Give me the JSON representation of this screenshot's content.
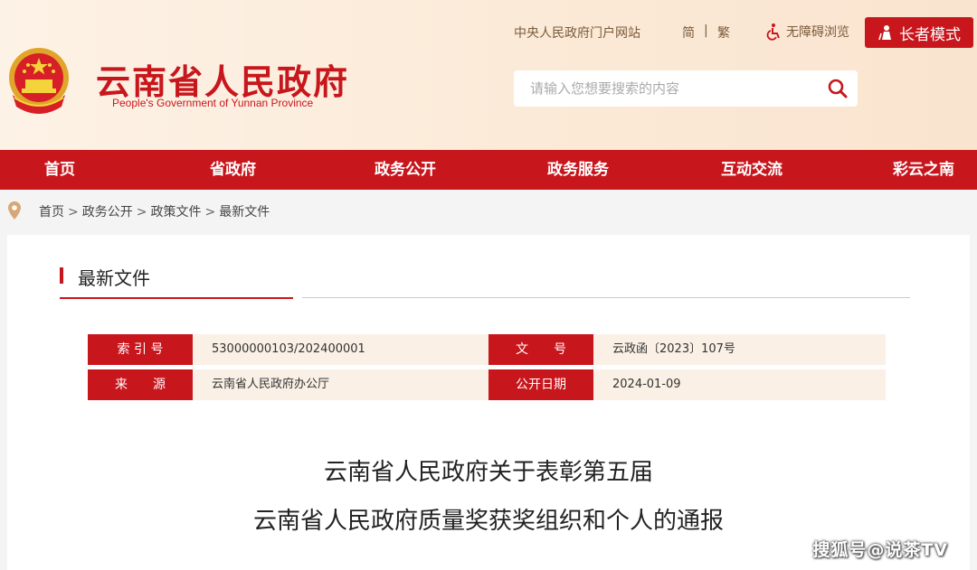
{
  "header": {
    "title": "云南省人民政府",
    "subtitle": "People's Government of Yunnan Province",
    "portal_link": "中央人民政府门户网站",
    "lang_simplified": "简",
    "lang_separator": "|",
    "lang_traditional": "繁",
    "accessible_label": "无障碍浏览",
    "elder_mode_label": "长者模式",
    "search_placeholder": "请输入您想要搜索的内容"
  },
  "nav": {
    "items": [
      "首页",
      "省政府",
      "政务公开",
      "政务服务",
      "互动交流",
      "彩云之南"
    ]
  },
  "breadcrumb": {
    "items": [
      "首页",
      "政务公开",
      "政策文件",
      "最新文件"
    ],
    "separator": ">"
  },
  "section": {
    "title": "最新文件"
  },
  "meta": {
    "index_label": "索 引 号",
    "index_value": "53000000103/202400001",
    "doc_no_label": "文　　号",
    "doc_no_value": "云政函〔2023〕107号",
    "source_label": "来　　源",
    "source_value": "云南省人民政府办公厅",
    "date_label": "公开日期",
    "date_value": "2024-01-09"
  },
  "document": {
    "title_line1": "云南省人民政府关于表彰第五届",
    "title_line2": "云南省人民政府质量奖获奖组织和个人的通报"
  },
  "watermark": "搜狐号@说茶TV",
  "colors": {
    "brand_red": "#c8161d",
    "header_bg": "#fbe9d6",
    "meta_value_bg": "#faf0e6"
  }
}
